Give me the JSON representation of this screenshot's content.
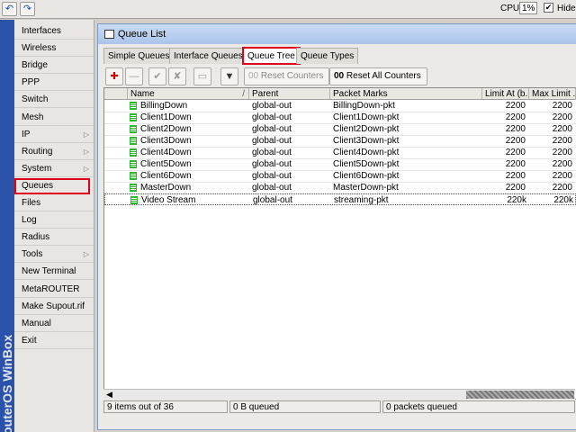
{
  "topbar": {
    "undo_glyph": "↶",
    "redo_glyph": "↷",
    "cpu_label": "CPU:",
    "cpu_value": "1%",
    "hide_label": "Hide",
    "hide_checked": "✔"
  },
  "brand": "RouterOS WinBox",
  "sidebar": {
    "items": [
      {
        "label": "Interfaces",
        "submenu": false
      },
      {
        "label": "Wireless",
        "submenu": false
      },
      {
        "label": "Bridge",
        "submenu": false
      },
      {
        "label": "PPP",
        "submenu": false
      },
      {
        "label": "Switch",
        "submenu": false
      },
      {
        "label": "Mesh",
        "submenu": false
      },
      {
        "label": "IP",
        "submenu": true
      },
      {
        "label": "Routing",
        "submenu": true
      },
      {
        "label": "System",
        "submenu": true
      },
      {
        "label": "Queues",
        "submenu": false,
        "highlighted": true
      },
      {
        "label": "Files",
        "submenu": false
      },
      {
        "label": "Log",
        "submenu": false
      },
      {
        "label": "Radius",
        "submenu": false
      },
      {
        "label": "Tools",
        "submenu": true
      },
      {
        "label": "New Terminal",
        "submenu": false
      },
      {
        "label": "MetaROUTER",
        "submenu": false
      },
      {
        "label": "Make Supout.rif",
        "submenu": false
      },
      {
        "label": "Manual",
        "submenu": false
      },
      {
        "label": "Exit",
        "submenu": false
      }
    ]
  },
  "window": {
    "title": "Queue List",
    "tabs": [
      {
        "label": "Simple Queues"
      },
      {
        "label": "Interface Queues"
      },
      {
        "label": "Queue Tree",
        "active": true
      },
      {
        "label": "Queue Types"
      }
    ],
    "toolbar": {
      "add_glyph": "✚",
      "remove_glyph": "—",
      "enable_glyph": "✔",
      "disable_glyph": "✘",
      "comment_glyph": "▭",
      "filter_glyph": "▼",
      "reset_counters_label": "Reset Counters",
      "reset_all_counters_label": "Reset All Counters",
      "reset_all_prefix": "00"
    },
    "columns": {
      "sort_glyph": "/",
      "name": "Name",
      "parent": "Parent",
      "packet_marks": "Packet Marks",
      "limit_at": "Limit At (b...",
      "max_limit": "Max Limit ..."
    },
    "rows": [
      {
        "name": "BillingDown",
        "parent": "global-out",
        "packet_marks": "BillingDown-pkt",
        "limit_at": "2200",
        "max_limit": "2200"
      },
      {
        "name": "Client1Down",
        "parent": "global-out",
        "packet_marks": "Client1Down-pkt",
        "limit_at": "2200",
        "max_limit": "2200"
      },
      {
        "name": "Client2Down",
        "parent": "global-out",
        "packet_marks": "Client2Down-pkt",
        "limit_at": "2200",
        "max_limit": "2200"
      },
      {
        "name": "Client3Down",
        "parent": "global-out",
        "packet_marks": "Client3Down-pkt",
        "limit_at": "2200",
        "max_limit": "2200"
      },
      {
        "name": "Client4Down",
        "parent": "global-out",
        "packet_marks": "Client4Down-pkt",
        "limit_at": "2200",
        "max_limit": "2200"
      },
      {
        "name": "Client5Down",
        "parent": "global-out",
        "packet_marks": "Client5Down-pkt",
        "limit_at": "2200",
        "max_limit": "2200"
      },
      {
        "name": "Client6Down",
        "parent": "global-out",
        "packet_marks": "Client6Down-pkt",
        "limit_at": "2200",
        "max_limit": "2200"
      },
      {
        "name": "MasterDown",
        "parent": "global-out",
        "packet_marks": "MasterDown-pkt",
        "limit_at": "2200",
        "max_limit": "2200"
      },
      {
        "name": "Video Stream",
        "parent": "global-out",
        "packet_marks": "streaming-pkt",
        "limit_at": "220k",
        "max_limit": "220k"
      }
    ],
    "scroll_left_glyph": "◀",
    "status": {
      "items": "9 items out of 36",
      "bytes_queued": "0 B queued",
      "packets_queued": "0 packets queued"
    }
  },
  "colors": {
    "highlight_red": "#e0001b",
    "brand_blue": "#2a52a8",
    "queue_icon_green": "#2db52d"
  }
}
